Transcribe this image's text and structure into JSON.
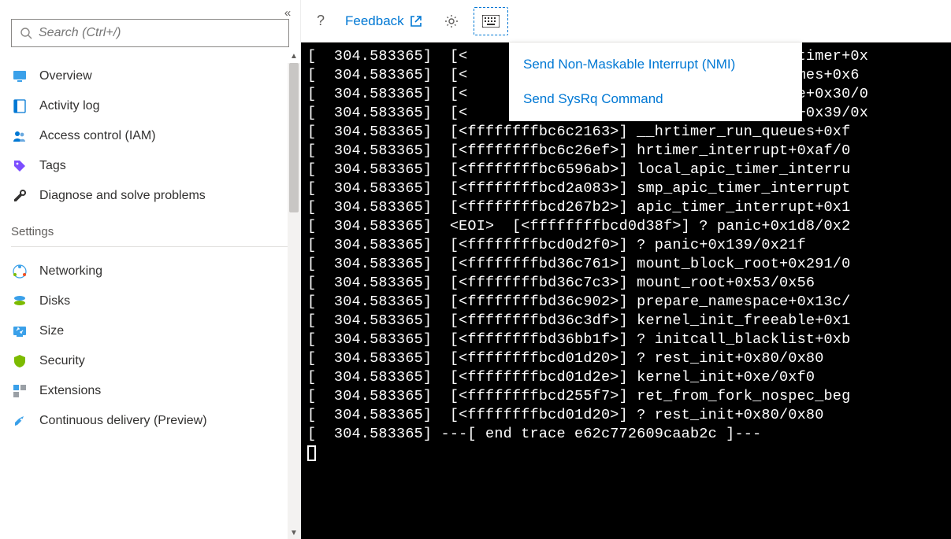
{
  "search": {
    "placeholder": "Search (Ctrl+/)"
  },
  "sidebar": {
    "items": [
      {
        "label": "Overview"
      },
      {
        "label": "Activity log"
      },
      {
        "label": "Access control (IAM)"
      },
      {
        "label": "Tags"
      },
      {
        "label": "Diagnose and solve problems"
      }
    ],
    "settings_heading": "Settings",
    "settings": [
      {
        "label": "Networking"
      },
      {
        "label": "Disks"
      },
      {
        "label": "Size"
      },
      {
        "label": "Security"
      },
      {
        "label": "Extensions"
      },
      {
        "label": "Continuous delivery (Preview)"
      }
    ]
  },
  "toolbar": {
    "help": "?",
    "feedback_label": "Feedback"
  },
  "dropdown": {
    "items": [
      "Send Non-Maskable Interrupt (NMI)",
      "Send SysRq Command"
    ]
  },
  "console": {
    "lines": [
      "[  304.583365]  [<                              ned_do_timer+0x",
      "[  304.583365]  [<                              cess_times+0x6",
      "[  304.583365]  [<                              d_handle+0x30/0",
      "[  304.583365]  [<                              d_timer+0x39/0x",
      "[  304.583365]  [<ffffffffbc6c2163>] __hrtimer_run_queues+0xf",
      "[  304.583365]  [<ffffffffbc6c26ef>] hrtimer_interrupt+0xaf/0",
      "[  304.583365]  [<ffffffffbc6596ab>] local_apic_timer_interru",
      "[  304.583365]  [<ffffffffbcd2a083>] smp_apic_timer_interrupt",
      "[  304.583365]  [<ffffffffbcd267b2>] apic_timer_interrupt+0x1",
      "[  304.583365]  <EOI>  [<ffffffffbcd0d38f>] ? panic+0x1d8/0x2",
      "[  304.583365]  [<ffffffffbcd0d2f0>] ? panic+0x139/0x21f",
      "[  304.583365]  [<ffffffffbd36c761>] mount_block_root+0x291/0",
      "[  304.583365]  [<ffffffffbd36c7c3>] mount_root+0x53/0x56",
      "[  304.583365]  [<ffffffffbd36c902>] prepare_namespace+0x13c/",
      "[  304.583365]  [<ffffffffbd36c3df>] kernel_init_freeable+0x1",
      "[  304.583365]  [<ffffffffbd36bb1f>] ? initcall_blacklist+0xb",
      "[  304.583365]  [<ffffffffbcd01d20>] ? rest_init+0x80/0x80",
      "[  304.583365]  [<ffffffffbcd01d2e>] kernel_init+0xe/0xf0",
      "[  304.583365]  [<ffffffffbcd255f7>] ret_from_fork_nospec_beg",
      "[  304.583365]  [<ffffffffbcd01d20>] ? rest_init+0x80/0x80",
      "[  304.583365] ---[ end trace e62c772609caab2c ]---"
    ]
  }
}
